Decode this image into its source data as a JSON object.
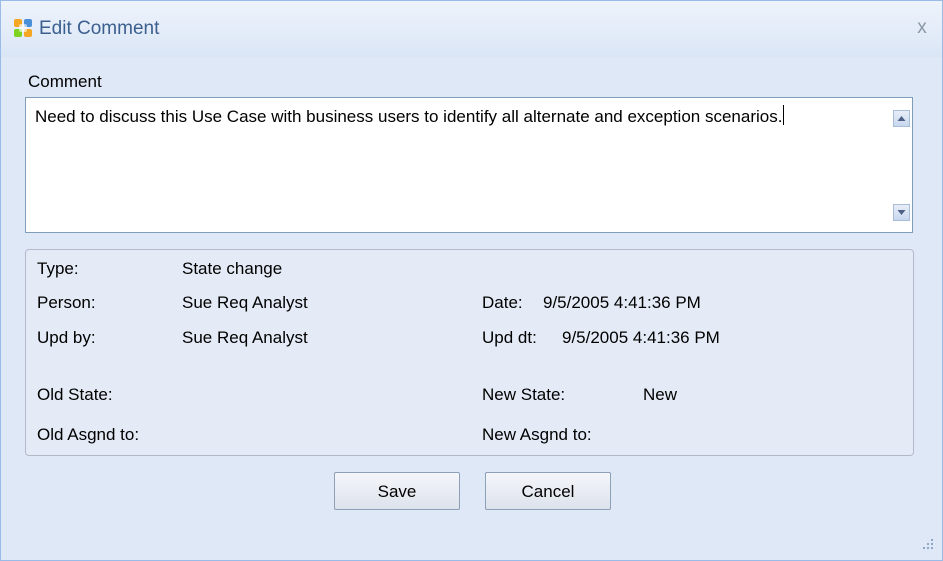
{
  "window": {
    "title": "Edit Comment",
    "close_symbol": "x",
    "icon": "app-logo-icon"
  },
  "comment": {
    "label": "Comment",
    "value": "Need to discuss this Use Case with business users to identify all alternate and exception scenarios."
  },
  "details": {
    "type_label": "Type:",
    "type_value": "State change",
    "person_label": "Person:",
    "person_value": "Sue Req Analyst",
    "date_label": "Date:",
    "date_value": "9/5/2005 4:41:36 PM",
    "updby_label": "Upd by:",
    "updby_value": "Sue Req Analyst",
    "upddt_label": "Upd dt:",
    "upddt_value": "9/5/2005 4:41:36 PM",
    "old_state_label": "Old State:",
    "old_state_value": "",
    "new_state_label": "New State:",
    "new_state_value": "New",
    "old_asgnd_label": "Old Asgnd to:",
    "old_asgnd_value": "",
    "new_asgnd_label": "New Asgnd to:",
    "new_asgnd_value": ""
  },
  "buttons": {
    "save": "Save",
    "cancel": "Cancel"
  },
  "colors": {
    "dialog_bg": "#dfe8f6",
    "border": "#99bbe8",
    "title_text": "#3b5f8f"
  }
}
